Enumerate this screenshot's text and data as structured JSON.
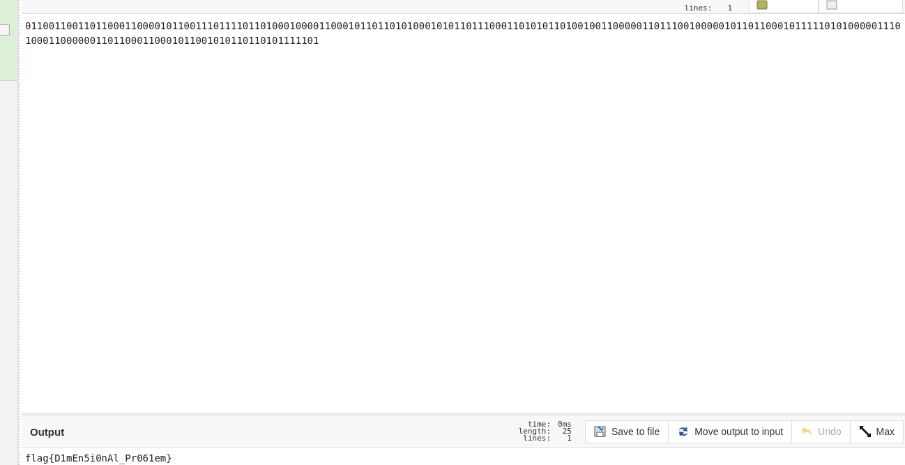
{
  "input": {
    "stats": [
      {
        "label": "lines:",
        "value": "1"
      }
    ],
    "header_buttons": [
      {
        "kind": "clear"
      },
      {
        "kind": "layout"
      }
    ],
    "lines": [
      "01100110011011000110000101100111011110110100010000110001011011010100010101101110001101010110100100110000011011100100000101101100010111110101000001110",
      "10001100000011011000110001011001010110110101111101"
    ]
  },
  "output": {
    "title": "Output",
    "stats": [
      {
        "label": "time:",
        "value": "0ms"
      },
      {
        "label": "length:",
        "value": "25"
      },
      {
        "label": "lines:",
        "value": "1"
      }
    ],
    "buttons": [
      {
        "kind": "save",
        "label": "Save to file",
        "disabled": false
      },
      {
        "kind": "move",
        "label": "Move output to input",
        "disabled": false
      },
      {
        "kind": "undo",
        "label": "Undo",
        "disabled": true
      },
      {
        "kind": "max",
        "label": "Max",
        "disabled": false
      }
    ],
    "text": "flag{D1mEn5i0nAl_Pr061em}"
  }
}
